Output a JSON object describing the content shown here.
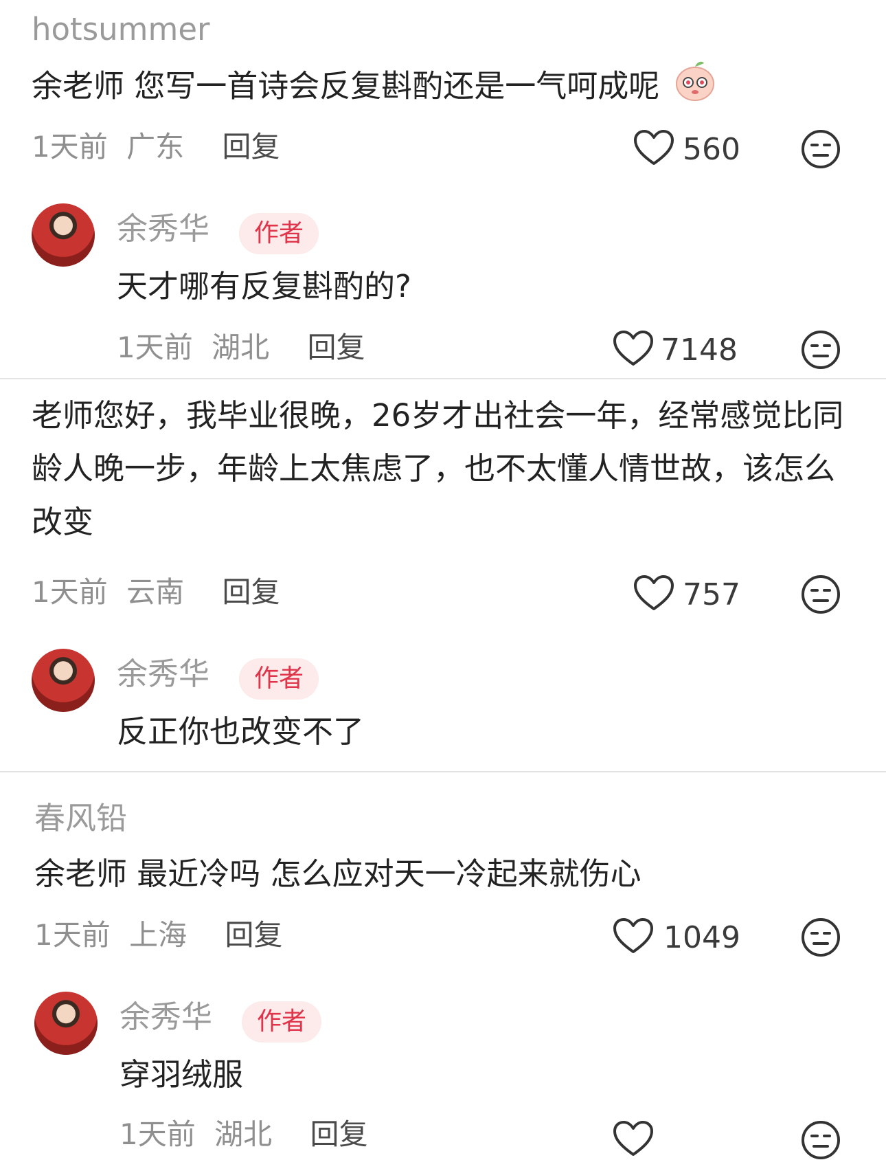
{
  "comments": [
    {
      "user": "hotsummer",
      "text": "余老师 您写一首诗会反复斟酌还是一气呵成呢",
      "time": "1天前",
      "location": "广东",
      "reply_label": "回复",
      "likes": "560",
      "reply": {
        "user": "余秀华",
        "badge": "作者",
        "text": "天才哪有反复斟酌的?",
        "time": "1天前",
        "location": "湖北",
        "reply_label": "回复",
        "likes": "7148"
      }
    },
    {
      "text": "老师您好，我毕业很晚，26岁才出社会一年，经常感觉比同龄人晚一步，年龄上太焦虑了，也不太懂人情世故，该怎么改变",
      "time": "1天前",
      "location": "云南",
      "reply_label": "回复",
      "likes": "757",
      "reply": {
        "user": "余秀华",
        "badge": "作者",
        "text": "反正你也改变不了"
      }
    },
    {
      "user": "春风铅",
      "text": "余老师 最近冷吗 怎么应对天一冷起来就伤心",
      "time": "1天前",
      "location": "上海",
      "reply_label": "回复",
      "likes": "1049",
      "reply": {
        "user": "余秀华",
        "badge": "作者",
        "text": "穿羽绒服",
        "time": "1天前",
        "location": "湖北",
        "reply_label": "回复"
      }
    }
  ],
  "icons": {
    "like": "heart-outline-icon",
    "dislike": "neutral-face-icon",
    "sticker": "peach-sticker-icon"
  }
}
